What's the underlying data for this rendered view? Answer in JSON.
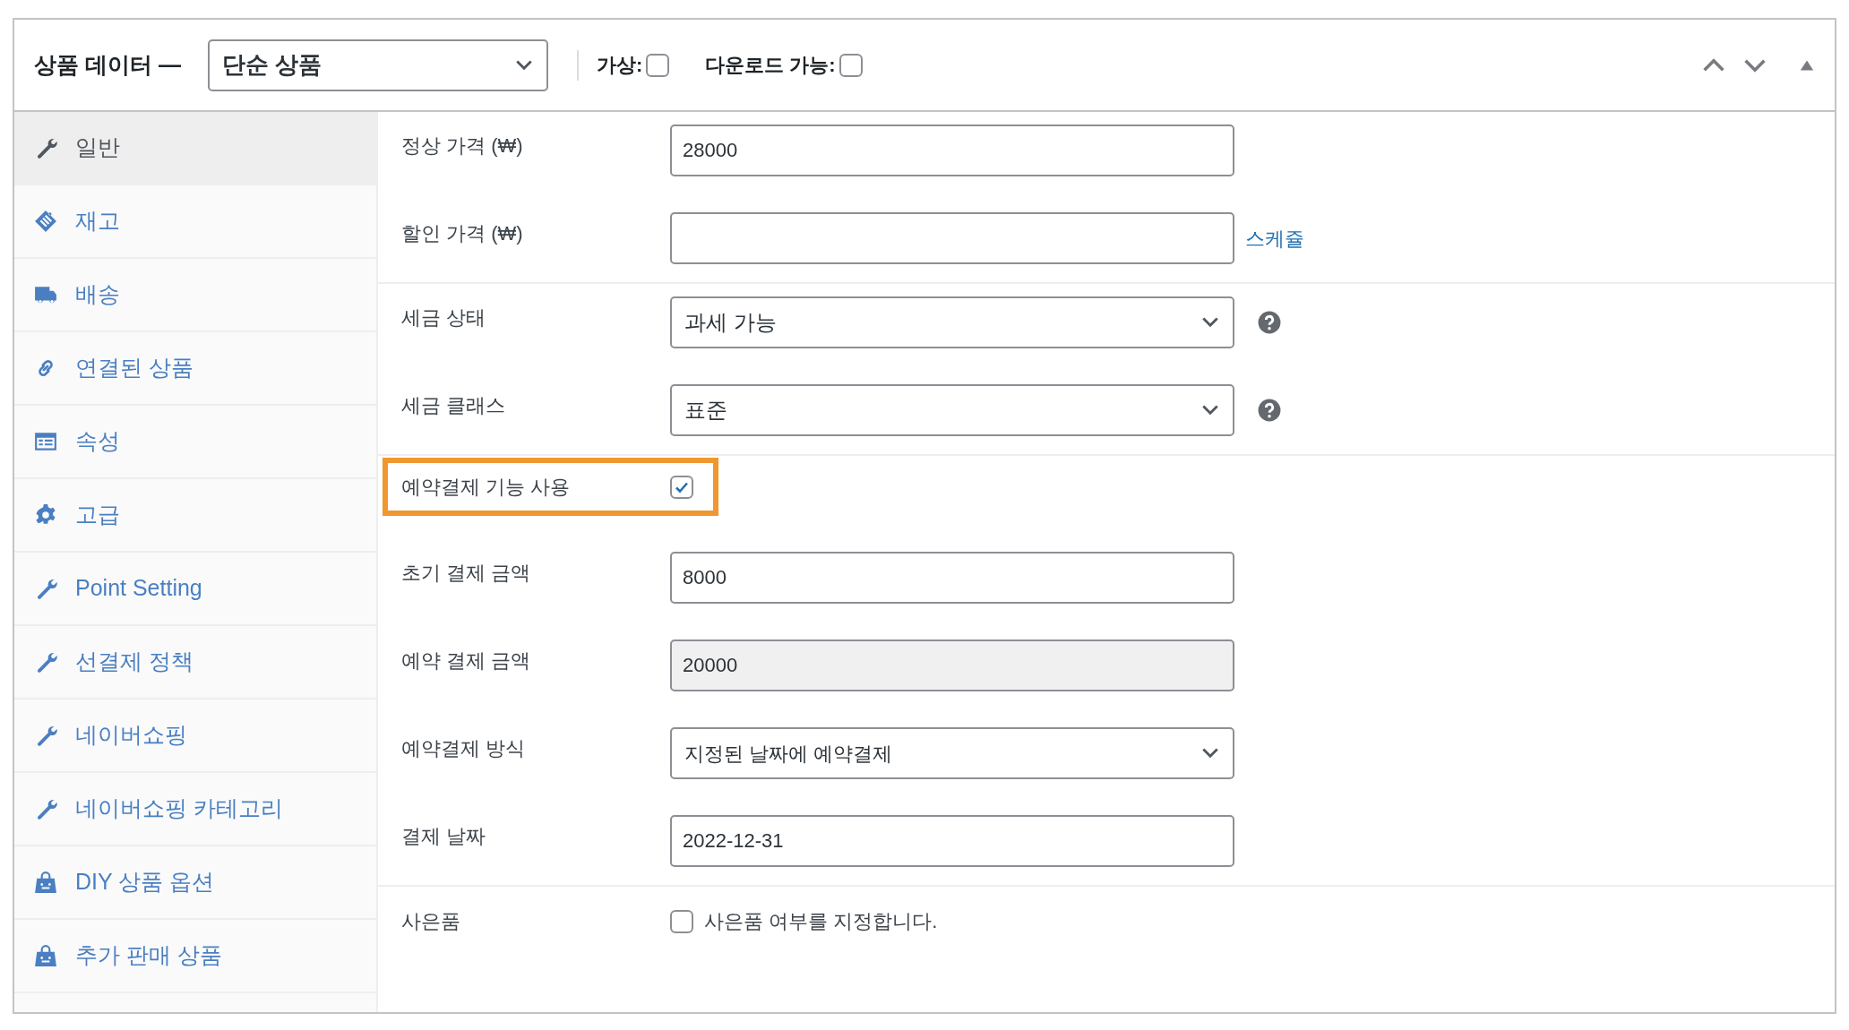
{
  "header": {
    "title": "상품 데이터 —",
    "product_type": {
      "value": "단순 상품"
    },
    "options": [
      {
        "label": "가상:",
        "checked": false
      },
      {
        "label": "다운로드 가능:",
        "checked": false
      }
    ]
  },
  "sidebar": {
    "items": [
      {
        "label": "일반",
        "kind": "wrench",
        "selected": true
      },
      {
        "label": "재고",
        "kind": "tag",
        "selected": false
      },
      {
        "label": "배송",
        "kind": "truck",
        "selected": false
      },
      {
        "label": "연결된 상품",
        "kind": "link",
        "selected": false
      },
      {
        "label": "속성",
        "kind": "table",
        "selected": false
      },
      {
        "label": "고급",
        "kind": "gear",
        "selected": false
      },
      {
        "label": "Point Setting",
        "kind": "wrench",
        "selected": false
      },
      {
        "label": "선결제 정책",
        "kind": "wrench",
        "selected": false
      },
      {
        "label": "네이버쇼핑",
        "kind": "wrench",
        "selected": false
      },
      {
        "label": "네이버쇼핑 카테고리",
        "kind": "wrench",
        "selected": false
      },
      {
        "label": "DIY 상품 옵션",
        "kind": "bag",
        "selected": false
      },
      {
        "label": "추가 판매 상품",
        "kind": "bag",
        "selected": false
      }
    ]
  },
  "sections": [
    {
      "rows": [
        {
          "kind": "text",
          "label": "정상 가격 (₩)",
          "value": "28000",
          "disabled": false,
          "help": false
        },
        {
          "kind": "text",
          "label": "할인 가격 (₩)",
          "value": "",
          "disabled": false,
          "help": false,
          "link": "스케쥴"
        }
      ]
    },
    {
      "rows": [
        {
          "kind": "select",
          "label": "세금 상태",
          "value": "과세 가능",
          "help": true
        },
        {
          "kind": "select",
          "label": "세금 클래스",
          "value": "표준",
          "help": true
        }
      ]
    },
    {
      "rows": [
        {
          "kind": "checkbox",
          "label": "예약결제 기능 사용",
          "checked": true,
          "highlighted": true
        },
        {
          "kind": "text",
          "label": "초기 결제 금액",
          "value": "8000",
          "disabled": false,
          "help": false
        },
        {
          "kind": "text",
          "label": "예약 결제 금액",
          "value": "20000",
          "disabled": true,
          "help": false
        },
        {
          "kind": "select",
          "label": "예약결제 방식",
          "value": "지정된 날짜에 예약결제",
          "help": false
        },
        {
          "kind": "text",
          "label": "결제 날짜",
          "value": "2022-12-31",
          "disabled": false,
          "help": false
        }
      ]
    },
    {
      "rows": [
        {
          "kind": "checkbox",
          "label": "사은품",
          "checked": false,
          "highlighted": false,
          "description": "사은품 여부를 지정합니다."
        }
      ]
    }
  ]
}
